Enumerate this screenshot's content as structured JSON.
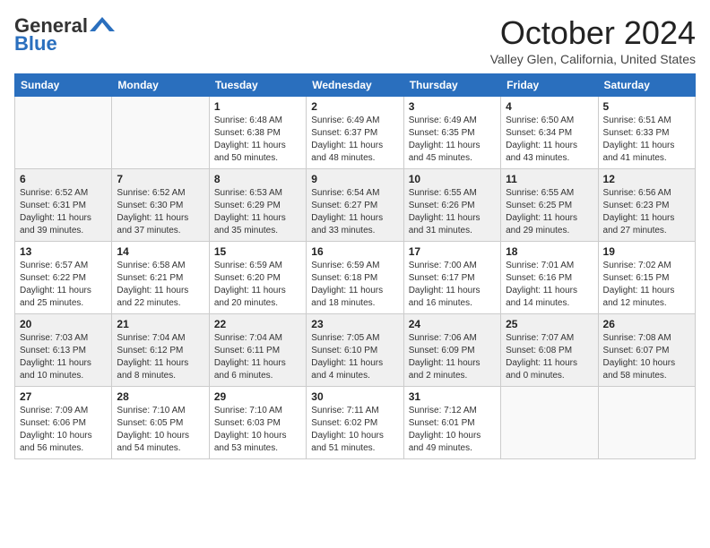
{
  "logo": {
    "general": "General",
    "blue": "Blue"
  },
  "header": {
    "month": "October 2024",
    "location": "Valley Glen, California, United States"
  },
  "weekdays": [
    "Sunday",
    "Monday",
    "Tuesday",
    "Wednesday",
    "Thursday",
    "Friday",
    "Saturday"
  ],
  "weeks": [
    [
      {
        "day": "",
        "text": "",
        "empty": true
      },
      {
        "day": "",
        "text": "",
        "empty": true
      },
      {
        "day": "1",
        "text": "Sunrise: 6:48 AM\nSunset: 6:38 PM\nDaylight: 11 hours and 50 minutes.",
        "empty": false
      },
      {
        "day": "2",
        "text": "Sunrise: 6:49 AM\nSunset: 6:37 PM\nDaylight: 11 hours and 48 minutes.",
        "empty": false
      },
      {
        "day": "3",
        "text": "Sunrise: 6:49 AM\nSunset: 6:35 PM\nDaylight: 11 hours and 45 minutes.",
        "empty": false
      },
      {
        "day": "4",
        "text": "Sunrise: 6:50 AM\nSunset: 6:34 PM\nDaylight: 11 hours and 43 minutes.",
        "empty": false
      },
      {
        "day": "5",
        "text": "Sunrise: 6:51 AM\nSunset: 6:33 PM\nDaylight: 11 hours and 41 minutes.",
        "empty": false
      }
    ],
    [
      {
        "day": "6",
        "text": "Sunrise: 6:52 AM\nSunset: 6:31 PM\nDaylight: 11 hours and 39 minutes.",
        "empty": false
      },
      {
        "day": "7",
        "text": "Sunrise: 6:52 AM\nSunset: 6:30 PM\nDaylight: 11 hours and 37 minutes.",
        "empty": false
      },
      {
        "day": "8",
        "text": "Sunrise: 6:53 AM\nSunset: 6:29 PM\nDaylight: 11 hours and 35 minutes.",
        "empty": false
      },
      {
        "day": "9",
        "text": "Sunrise: 6:54 AM\nSunset: 6:27 PM\nDaylight: 11 hours and 33 minutes.",
        "empty": false
      },
      {
        "day": "10",
        "text": "Sunrise: 6:55 AM\nSunset: 6:26 PM\nDaylight: 11 hours and 31 minutes.",
        "empty": false
      },
      {
        "day": "11",
        "text": "Sunrise: 6:55 AM\nSunset: 6:25 PM\nDaylight: 11 hours and 29 minutes.",
        "empty": false
      },
      {
        "day": "12",
        "text": "Sunrise: 6:56 AM\nSunset: 6:23 PM\nDaylight: 11 hours and 27 minutes.",
        "empty": false
      }
    ],
    [
      {
        "day": "13",
        "text": "Sunrise: 6:57 AM\nSunset: 6:22 PM\nDaylight: 11 hours and 25 minutes.",
        "empty": false
      },
      {
        "day": "14",
        "text": "Sunrise: 6:58 AM\nSunset: 6:21 PM\nDaylight: 11 hours and 22 minutes.",
        "empty": false
      },
      {
        "day": "15",
        "text": "Sunrise: 6:59 AM\nSunset: 6:20 PM\nDaylight: 11 hours and 20 minutes.",
        "empty": false
      },
      {
        "day": "16",
        "text": "Sunrise: 6:59 AM\nSunset: 6:18 PM\nDaylight: 11 hours and 18 minutes.",
        "empty": false
      },
      {
        "day": "17",
        "text": "Sunrise: 7:00 AM\nSunset: 6:17 PM\nDaylight: 11 hours and 16 minutes.",
        "empty": false
      },
      {
        "day": "18",
        "text": "Sunrise: 7:01 AM\nSunset: 6:16 PM\nDaylight: 11 hours and 14 minutes.",
        "empty": false
      },
      {
        "day": "19",
        "text": "Sunrise: 7:02 AM\nSunset: 6:15 PM\nDaylight: 11 hours and 12 minutes.",
        "empty": false
      }
    ],
    [
      {
        "day": "20",
        "text": "Sunrise: 7:03 AM\nSunset: 6:13 PM\nDaylight: 11 hours and 10 minutes.",
        "empty": false
      },
      {
        "day": "21",
        "text": "Sunrise: 7:04 AM\nSunset: 6:12 PM\nDaylight: 11 hours and 8 minutes.",
        "empty": false
      },
      {
        "day": "22",
        "text": "Sunrise: 7:04 AM\nSunset: 6:11 PM\nDaylight: 11 hours and 6 minutes.",
        "empty": false
      },
      {
        "day": "23",
        "text": "Sunrise: 7:05 AM\nSunset: 6:10 PM\nDaylight: 11 hours and 4 minutes.",
        "empty": false
      },
      {
        "day": "24",
        "text": "Sunrise: 7:06 AM\nSunset: 6:09 PM\nDaylight: 11 hours and 2 minutes.",
        "empty": false
      },
      {
        "day": "25",
        "text": "Sunrise: 7:07 AM\nSunset: 6:08 PM\nDaylight: 11 hours and 0 minutes.",
        "empty": false
      },
      {
        "day": "26",
        "text": "Sunrise: 7:08 AM\nSunset: 6:07 PM\nDaylight: 10 hours and 58 minutes.",
        "empty": false
      }
    ],
    [
      {
        "day": "27",
        "text": "Sunrise: 7:09 AM\nSunset: 6:06 PM\nDaylight: 10 hours and 56 minutes.",
        "empty": false
      },
      {
        "day": "28",
        "text": "Sunrise: 7:10 AM\nSunset: 6:05 PM\nDaylight: 10 hours and 54 minutes.",
        "empty": false
      },
      {
        "day": "29",
        "text": "Sunrise: 7:10 AM\nSunset: 6:03 PM\nDaylight: 10 hours and 53 minutes.",
        "empty": false
      },
      {
        "day": "30",
        "text": "Sunrise: 7:11 AM\nSunset: 6:02 PM\nDaylight: 10 hours and 51 minutes.",
        "empty": false
      },
      {
        "day": "31",
        "text": "Sunrise: 7:12 AM\nSunset: 6:01 PM\nDaylight: 10 hours and 49 minutes.",
        "empty": false
      },
      {
        "day": "",
        "text": "",
        "empty": true
      },
      {
        "day": "",
        "text": "",
        "empty": true
      }
    ]
  ]
}
